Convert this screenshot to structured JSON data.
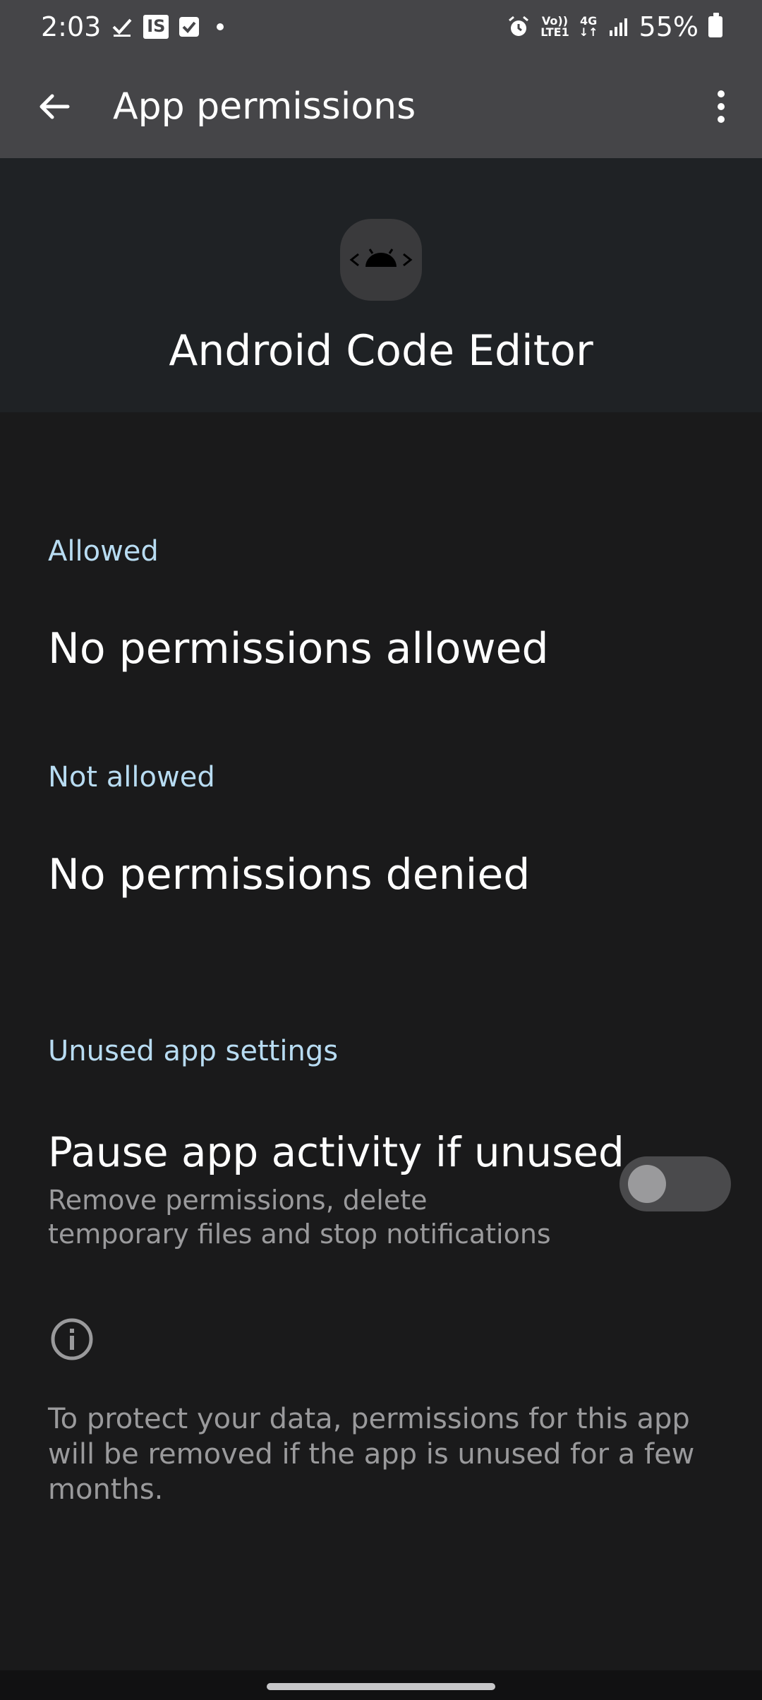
{
  "status_bar": {
    "time": "2:03",
    "notif_box_text": "IS",
    "network_top": "Vo))",
    "network_bottom": "LTE1",
    "network_type": "4G",
    "battery": "55%"
  },
  "app_bar": {
    "title": "App permissions",
    "back_icon": "arrow-left-icon",
    "more_icon": "more-vert-icon"
  },
  "header": {
    "app_icon": "android-code-icon",
    "app_name": "Android Code Editor"
  },
  "sections": {
    "allowed_label": "Allowed",
    "allowed_value": "No permissions allowed",
    "not_allowed_label": "Not allowed",
    "not_allowed_value": "No permissions denied",
    "unused_label": "Unused app settings"
  },
  "toggle": {
    "title": "Pause app activity if unused",
    "subtitle": "Remove permissions, delete temporary files and stop notifications",
    "state": "off"
  },
  "info": {
    "icon": "info-icon",
    "text": "To protect your data, permissions for this app will be removed if the app is unused for a few months."
  },
  "colors": {
    "app_bar_bg": "#454548",
    "header_bg": "#1f2225",
    "page_bg": "#1a1a1b",
    "section_label": "#b8dcf2",
    "secondary_text": "#9a9a9c"
  }
}
